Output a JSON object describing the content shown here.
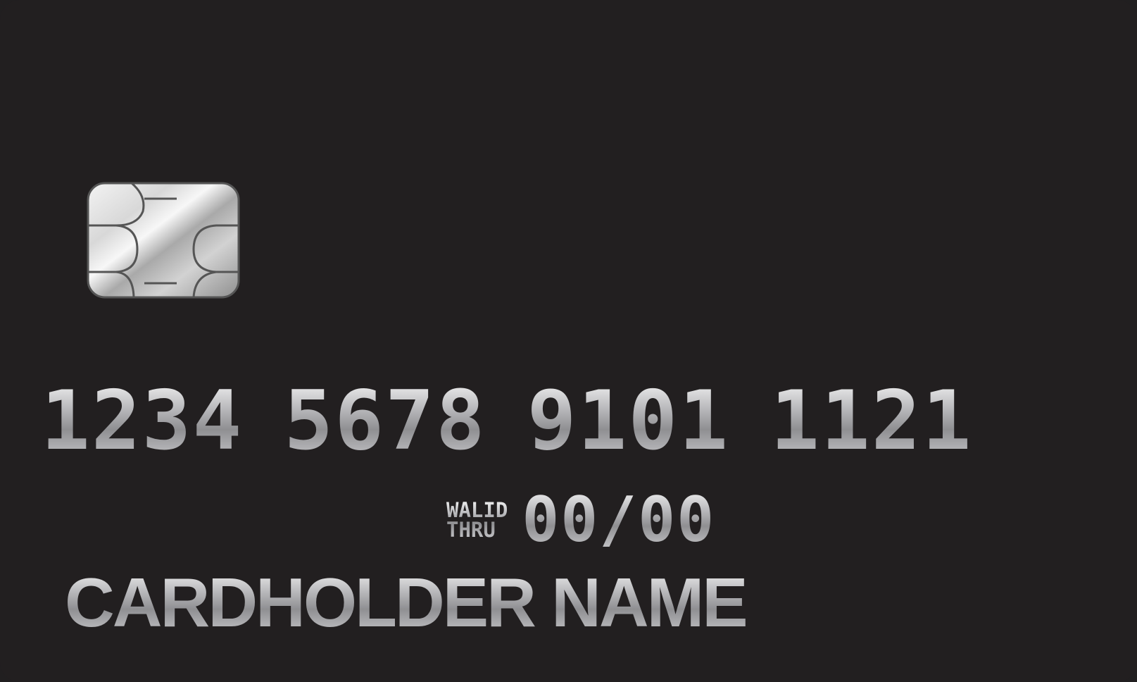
{
  "card": {
    "background_color": "#221f20",
    "chip_icon": "emv-chip-icon",
    "number_groups": [
      "1234",
      "5678",
      "9101",
      "1121"
    ],
    "valid_label_line1": "WALID",
    "valid_label_line2": "THRU",
    "expiry": "00/00",
    "cardholder_name": "CARDHOLDER NAME",
    "text_color": "#b8b8bb"
  }
}
